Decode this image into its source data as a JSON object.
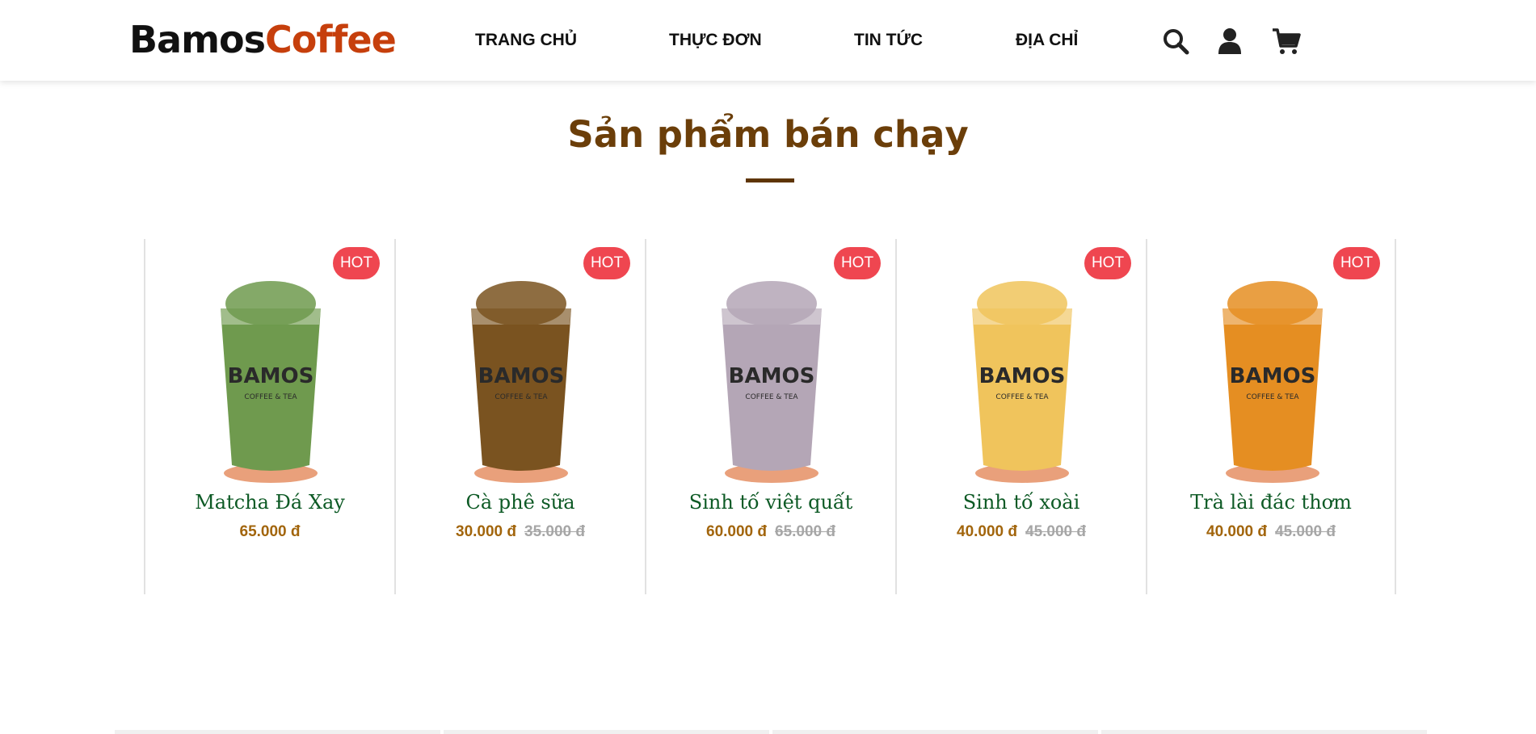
{
  "header": {
    "logo_part1": "Bamos",
    "logo_part2": "Coffee",
    "nav": [
      {
        "label": "TRANG CHỦ"
      },
      {
        "label": "THỰC ĐƠN"
      },
      {
        "label": "TIN TỨC"
      },
      {
        "label": "ĐỊA CHỈ"
      }
    ],
    "icons": [
      "search-icon",
      "user-icon",
      "cart-icon"
    ]
  },
  "section": {
    "title": "Sản phẩm bán chạy"
  },
  "products": [
    {
      "name": "Matcha Đá Xay",
      "price": "65.000 đ",
      "old_price": "",
      "badge": "HOT",
      "color": "#6f9a4e"
    },
    {
      "name": "Cà phê sữa",
      "price": "30.000 đ",
      "old_price": "35.000 đ",
      "badge": "HOT",
      "color": "#7a5320"
    },
    {
      "name": "Sinh tố việt quất",
      "price": "60.000 đ",
      "old_price": "65.000 đ",
      "badge": "HOT",
      "color": "#b4a6b6"
    },
    {
      "name": "Sinh tố xoài",
      "price": "40.000 đ",
      "old_price": "45.000 đ",
      "badge": "HOT",
      "color": "#f0c45c"
    },
    {
      "name": "Trà lài đác thơm",
      "price": "40.000 đ",
      "old_price": "45.000 đ",
      "badge": "HOT",
      "color": "#e58e22"
    }
  ],
  "colors": {
    "brand_accent": "#c63f0c",
    "title": "#6b3e09",
    "product_name": "#0d5a25",
    "price": "#a2650c",
    "badge": "#ef4650"
  }
}
